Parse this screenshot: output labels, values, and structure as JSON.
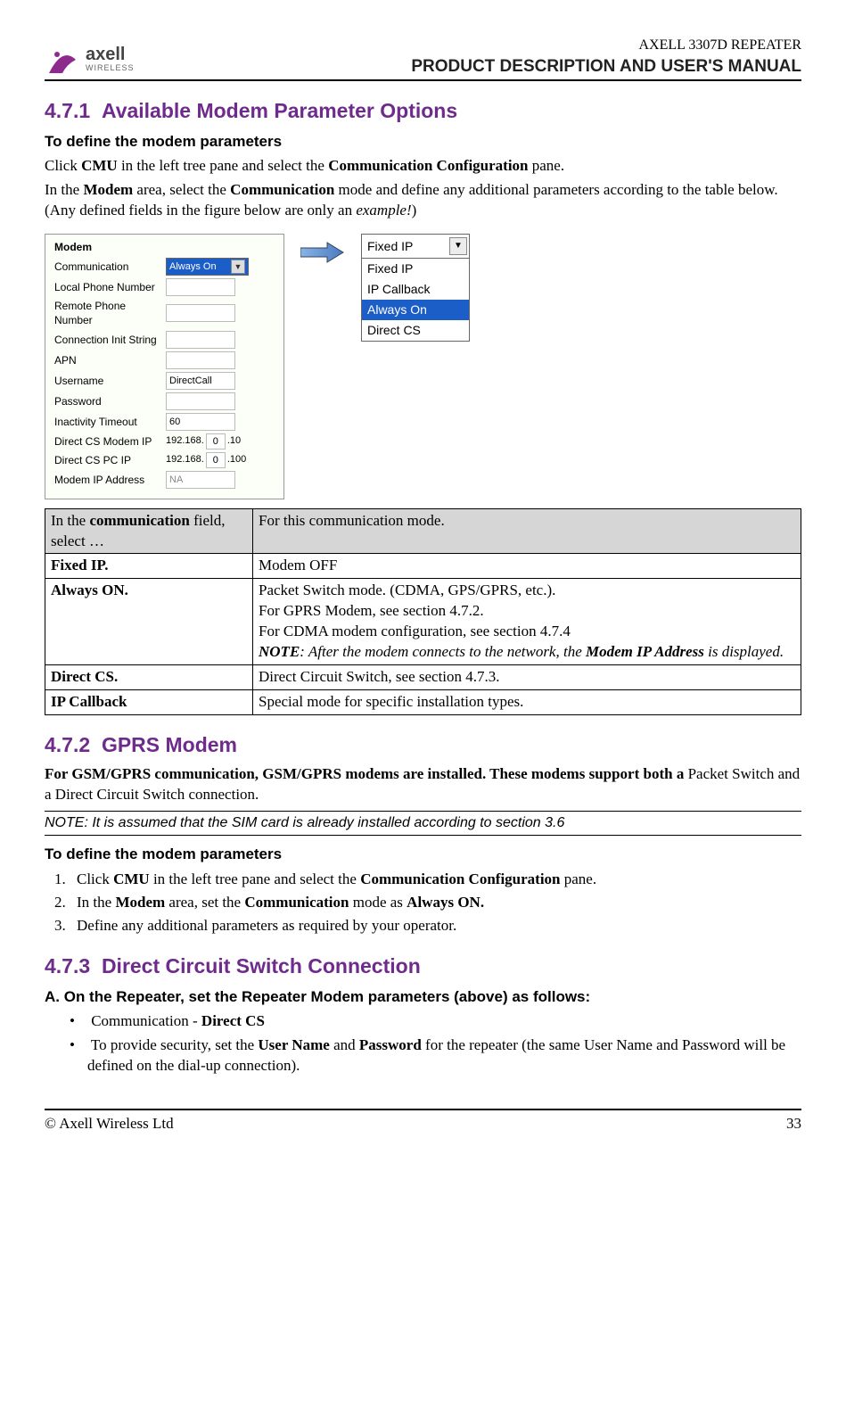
{
  "header": {
    "logo_text": "axell",
    "logo_sub": "WIRELESS",
    "line1": "AXELL 3307D REPEATER",
    "line2": "PRODUCT DESCRIPTION AND USER'S MANUAL"
  },
  "s471": {
    "num": "4.7.1",
    "title": "Available Modem Parameter Options",
    "h3": "To define the modem parameters",
    "p1a": "Click ",
    "p1b": "CMU",
    "p1c": " in the left tree pane and select the ",
    "p1d": "Communication Configuration",
    "p1e": " pane.",
    "p2a": "In the ",
    "p2b": "Modem",
    "p2c": " area, select the ",
    "p2d": "Communication",
    "p2e": " mode and define any additional parameters according to the table below. (Any defined fields in the figure below are only an ",
    "p2f": "example!",
    "p2g": ")"
  },
  "panel": {
    "title": "Modem",
    "rows": {
      "communication": "Communication",
      "communication_val": "Always On",
      "local_phone": "Local Phone Number",
      "remote_phone": "Remote Phone Number",
      "conn_init": "Connection Init String",
      "apn": "APN",
      "username": "Username",
      "username_val": "DirectCall",
      "password": "Password",
      "inactivity": "Inactivity Timeout",
      "inactivity_val": "60",
      "dcs_modem": "Direct CS Modem IP",
      "dcs_modem_prefix": "192.168.",
      "dcs_modem_a": "0",
      "dcs_modem_b": ".10",
      "dcs_pc": "Direct CS PC IP",
      "dcs_pc_prefix": "192.168.",
      "dcs_pc_a": "0",
      "dcs_pc_b": ".100",
      "modem_ip": "Modem IP Address",
      "modem_ip_val": "NA"
    }
  },
  "dropdown": {
    "selected": "Fixed IP",
    "items": [
      "Fixed IP",
      "IP Callback",
      "Always On",
      "Direct CS"
    ]
  },
  "table": {
    "h1a": "In the ",
    "h1b": "communication",
    "h1c": " field, select …",
    "h2": "For this communication mode.",
    "rows": [
      {
        "c1": "Fixed IP.",
        "c2": "Modem OFF"
      },
      {
        "c1": "Always ON.",
        "l1": "Packet Switch mode. (CDMA, GPS/GPRS, etc.).",
        "l2": "For GPRS Modem, see section 4.7.2.",
        "l3": "For CDMA modem configuration, see section 4.7.4",
        "na": "NOTE",
        "nb": ": After the modem connects to the network, the ",
        "nc": "Modem IP Address",
        "nd": " is displayed."
      },
      {
        "c1": "Direct CS.",
        "c2": "Direct Circuit Switch, see section 4.7.3."
      },
      {
        "c1": "IP Callback",
        "c2": "Special mode for specific installation types."
      }
    ]
  },
  "s472": {
    "num": "4.7.2",
    "title": "GPRS Modem",
    "p1a": "For GSM/GPRS communication, GSM/GPRS modems are installed. These modems support both a",
    "p1b": " Packet Switch and a Direct Circuit Switch connection.",
    "note": "NOTE: It is assumed that the SIM card is already installed according to section 3.6",
    "h3": "To define the modem parameters",
    "li1a": "Click ",
    "li1b": "CMU",
    "li1c": " in the left tree pane and select the ",
    "li1d": "Communication Configuration",
    "li1e": " pane.",
    "li2a": "In the ",
    "li2b": "Modem",
    "li2c": " area, set the ",
    "li2d": "Communication",
    "li2e": " mode as ",
    "li2f": "Always ON.",
    "li3": "Define any additional parameters as required by your operator."
  },
  "s473": {
    "num": "4.7.3",
    "title": "Direct Circuit Switch Connection",
    "h3": "A. On the Repeater, set the Repeater Modem parameters (above) as follows:",
    "b1a": "Communication - ",
    "b1b": "Direct CS",
    "b2a": "To provide security, set the ",
    "b2b": "User Name",
    "b2c": " and ",
    "b2d": "Password",
    "b2e": " for the repeater (the same User Name and Password will be defined on the dial-up connection)."
  },
  "footer": {
    "left": "© Axell Wireless Ltd",
    "right": "33"
  }
}
